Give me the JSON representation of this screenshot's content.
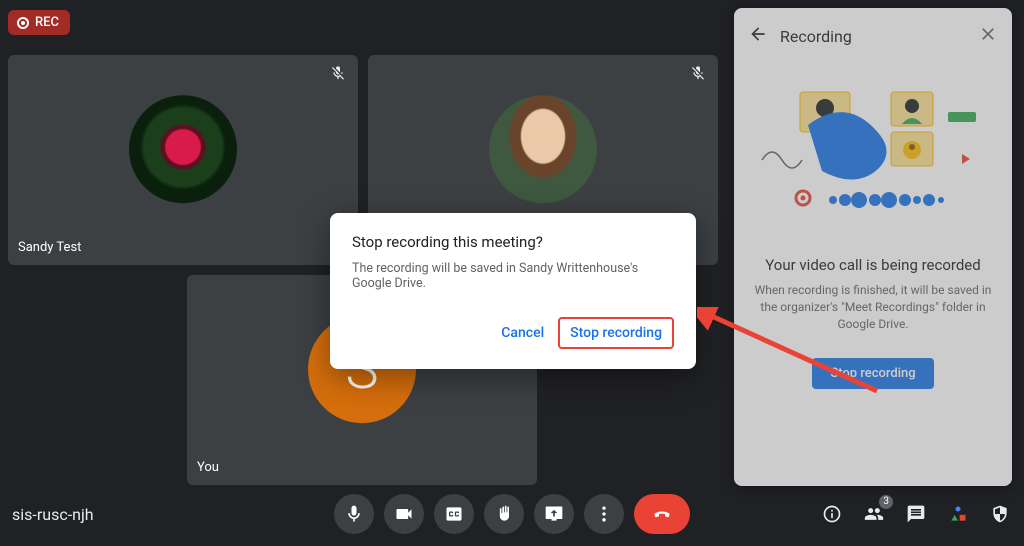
{
  "rec_label": "REC",
  "tiles": {
    "t1_name": "Sandy Test",
    "t3_name": "You",
    "muted_alt": "Microphone off",
    "you_letter": "S"
  },
  "footer": {
    "meeting_code": "sis-rusc-njh",
    "participant_count": "3"
  },
  "side_panel": {
    "title": "Recording",
    "msg_title": "Your video call is being recorded",
    "msg_body": "When recording is finished, it will be saved in the organizer's \"Meet Recordings\" folder in Google Drive.",
    "stop_label": "Stop recording"
  },
  "dialog": {
    "title": "Stop recording this meeting?",
    "body": "The recording will be saved in Sandy Writtenhouse's Google Drive.",
    "cancel_label": "Cancel",
    "confirm_label": "Stop recording"
  },
  "icons": {
    "mic": "mic",
    "cam": "cam",
    "cc": "cc",
    "hand": "hand",
    "present": "present",
    "more": "more",
    "end": "end",
    "info": "info",
    "people": "people",
    "chat": "chat",
    "activities": "activities",
    "host": "host",
    "back": "back",
    "close": "close",
    "mic_off": "mic_off"
  }
}
